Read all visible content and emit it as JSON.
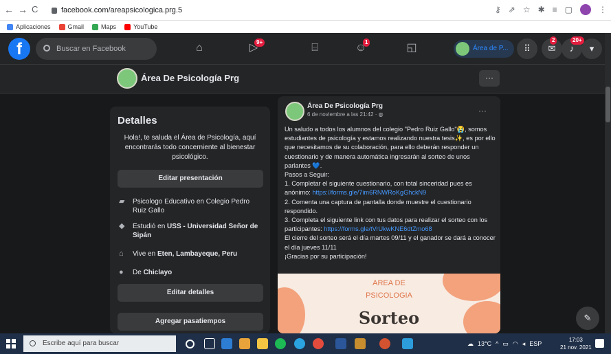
{
  "browser": {
    "url": "facebook.com/areapsicologica.prg.5",
    "bookmarks": [
      "Aplicaciones",
      "Gmail",
      "Maps",
      "YouTube"
    ]
  },
  "header": {
    "search_placeholder": "Buscar en Facebook",
    "watch_badge": "9+",
    "groups_badge": "1",
    "profile_name": "Área de P...",
    "messenger_badge": "2",
    "notifications_badge": "20+"
  },
  "page": {
    "name": "Área De Psicología Prg",
    "more": "···"
  },
  "details": {
    "title": "Detalles",
    "bio": "Hola!, te saluda el Área de Psicología, aquí encontrarás todo concerniente al bienestar psicológico.",
    "edit_presentation": "Editar presentación",
    "work": "Psicologo Educativo en Colegio Pedro Ruiz Gallo",
    "study_prefix": "Estudió en ",
    "study_school": "USS - Universidad Señor de Sipán",
    "lives_prefix": "Vive en ",
    "lives_place": "Eten, Lambayeque, Peru",
    "from_prefix": "De ",
    "from_place": "Chiclayo",
    "edit_details": "Editar detalles",
    "add_hobbies": "Agregar pasatiempos"
  },
  "post": {
    "author": "Área De Psicología Prg",
    "date": "6 de noviembre a las 21:42 · ",
    "more": "···",
    "p1": "Un saludo a todos los alumnos del colegio \"Pedro Ruiz Gallo\"😭, somos estudiantes de psicología y estamos realizando nuestra tesis✨, es por ello que necesitamos de su colaboración, para ello deberán responder un cuestionario y de manera automática ingresarán al sorteo de unos parlantes 💙.",
    "p2": "Pasos a Seguir:",
    "p3": "1. Completar el siguiente cuestionario, con total sinceridad pues es anónimo: ",
    "link1": "https://forms.gle/7im6RNWRoKgGhckN9",
    "p4": "2. Comenta una captura de pantalla donde muestre el cuestionario respondido.",
    "p5": "3. Completa el siguiente link con tus datos para realizar el sorteo con los participantes: ",
    "link2": "https://forms.gle/tVrUkwKNE6dtZmo68",
    "p6": "El cierre del sorteo será el día martes 09/11 y el ganador se dará a conocer el día jueves 11/11",
    "p7": "¡Gracias por su participación!",
    "image_line1": "AREA DE",
    "image_line2": "PSICOLOGIA",
    "image_line3": "Sorteo"
  },
  "taskbar": {
    "search_placeholder": "Escribe aquí para buscar",
    "weather": "13°C",
    "lang": "ESP",
    "time": "17:03",
    "date": "21 nov. 2021"
  }
}
